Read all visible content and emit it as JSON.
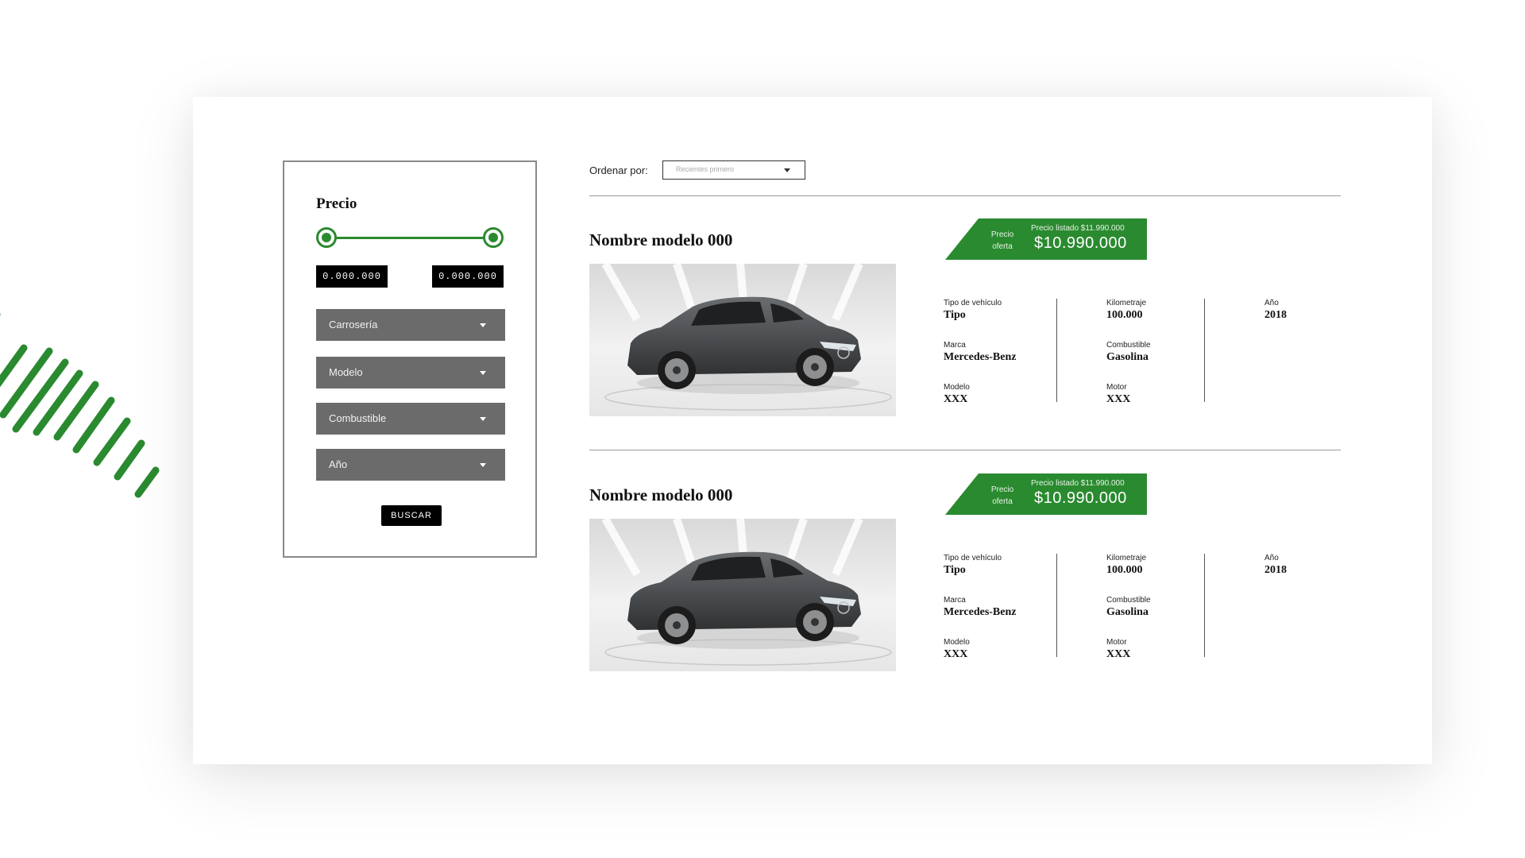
{
  "colors": {
    "accent": "#2a8a2f",
    "filter_select_bg": "#6b6b6b",
    "black": "#000000"
  },
  "filters": {
    "title": "Precio",
    "price_min": "0.000.000",
    "price_max": "0.000.000",
    "price_range_fraction": [
      0,
      1
    ],
    "selects": [
      {
        "label": "Carrosería"
      },
      {
        "label": "Modelo"
      },
      {
        "label": "Combustible"
      },
      {
        "label": "Año"
      }
    ],
    "search_label": "BUSCAR"
  },
  "sort": {
    "label": "Ordenar por:",
    "selected": "Recientes primero"
  },
  "listings": [
    {
      "name": "Nombre modelo 000",
      "offer_label_1": "Precio",
      "offer_label_2": "oferta",
      "listed_price": "Precio listado $11.990.000",
      "offer_price": "$10.990.000",
      "specs": {
        "tipo_label": "Tipo de vehículo",
        "tipo": "Tipo",
        "marca_label": "Marca",
        "marca": "Mercedes-Benz",
        "modelo_label": "Modelo",
        "modelo": "XXX",
        "km_label": "Kilometraje",
        "km": "100.000",
        "combustible_label": "Combustible",
        "combustible": "Gasolina",
        "motor_label": "Motor",
        "motor": "XXX",
        "ano_label": "Año",
        "ano": "2018"
      }
    },
    {
      "name": "Nombre modelo 000",
      "offer_label_1": "Precio",
      "offer_label_2": "oferta",
      "listed_price": "Precio listado $11.990.000",
      "offer_price": "$10.990.000",
      "specs": {
        "tipo_label": "Tipo de vehículo",
        "tipo": "Tipo",
        "marca_label": "Marca",
        "marca": "Mercedes-Benz",
        "modelo_label": "Modelo",
        "modelo": "XXX",
        "km_label": "Kilometraje",
        "km": "100.000",
        "combustible_label": "Combustible",
        "combustible": "Gasolina",
        "motor_label": "Motor",
        "motor": "XXX",
        "ano_label": "Año",
        "ano": "2018"
      }
    }
  ]
}
